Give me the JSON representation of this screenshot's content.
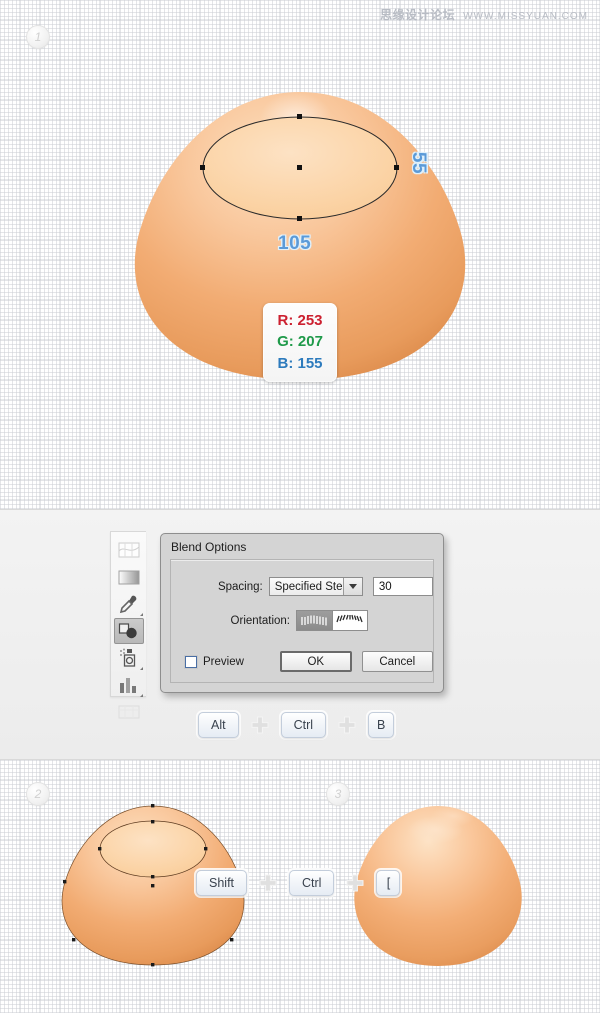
{
  "watermark": {
    "cn_text": "思缘设计论坛",
    "url_text": "WWW.MISSYUAN.COM"
  },
  "steps": {
    "badge_1": "1",
    "badge_2": "2",
    "badge_3": "3"
  },
  "measurements": {
    "width_label": "105",
    "height_label": "55"
  },
  "color_readout": {
    "r_line": "R: 253",
    "g_line": "G: 207",
    "b_line": "B: 155",
    "r_color": "#cc2030",
    "g_color": "#1f9a4a",
    "b_color": "#2d7bbd",
    "swatch_hex": "#fdcf9b"
  },
  "artwork": {
    "egg_fill_light": "#fbd8b2",
    "egg_fill_mid": "#f2ab6e",
    "egg_fill_dark": "#e49354",
    "inner_ellipse_fill": "#fbd4a6",
    "path_stroke": "#2b2b2b",
    "anchor_color": "#111111"
  },
  "dialog": {
    "title": "Blend Options",
    "spacing_label": "Spacing:",
    "spacing_value": "Specified Steps",
    "steps_value": "30",
    "orientation_label": "Orientation:",
    "orientation_options": [
      "align-to-page",
      "align-to-path"
    ],
    "orientation_selected": "align-to-page",
    "preview_label": "Preview",
    "preview_checked": false,
    "ok_label": "OK",
    "cancel_label": "Cancel"
  },
  "toolbar": {
    "tools": [
      {
        "name": "mesh-tool",
        "active": false
      },
      {
        "name": "gradient-tool",
        "active": false
      },
      {
        "name": "eyedropper-tool",
        "active": false
      },
      {
        "name": "blend-tool",
        "active": true
      },
      {
        "name": "live-paint-bucket-tool",
        "active": false
      },
      {
        "name": "column-graph-tool",
        "active": false
      },
      {
        "name": "artboard-tool",
        "active": false
      }
    ]
  },
  "shortcuts": {
    "combo_1": {
      "keys": [
        "Alt",
        "Ctrl",
        "B"
      ],
      "separator": "+"
    },
    "combo_2": {
      "keys": [
        "Shift",
        "Ctrl",
        "["
      ],
      "separator": "+"
    }
  }
}
